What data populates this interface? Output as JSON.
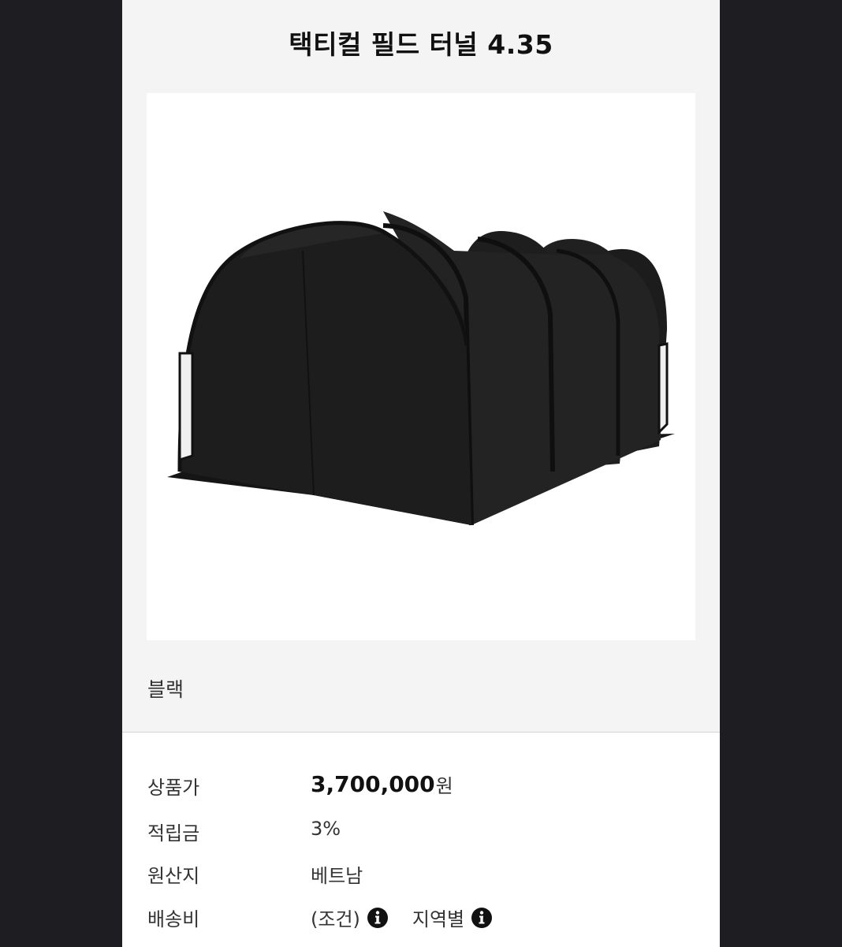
{
  "product": {
    "title": "택티컬 필드 터널 4.35",
    "color_option": "블랙"
  },
  "details": {
    "price_label": "상품가",
    "price_value": "3,700,000",
    "price_unit": "원",
    "points_label": "적립금",
    "points_value": "3%",
    "origin_label": "원산지",
    "origin_value": "베트남",
    "shipping_label": "배송비",
    "shipping_condition": "(조건)",
    "shipping_region": "지역별"
  },
  "icons": {
    "info": "info-icon"
  },
  "colors": {
    "background": "#1e1e22",
    "panel": "#f4f4f4",
    "tent": "#1a1a1a"
  }
}
